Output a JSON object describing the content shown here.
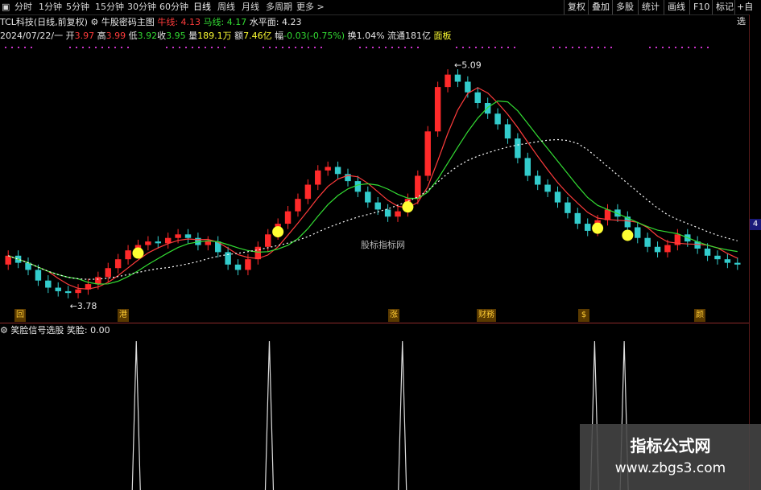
{
  "toolbar": {
    "periods": [
      "分时",
      "1分钟",
      "5分钟",
      "15分钟",
      "30分钟",
      "60分钟",
      "日线",
      "周线",
      "月线",
      "多周期",
      "更多"
    ],
    "active": "日线",
    "right_buttons": [
      "复权",
      "叠加",
      "多股",
      "统计",
      "画线",
      "F10",
      "标记",
      "+自选"
    ]
  },
  "header": {
    "stock": "TCL科技(日线,前复权)",
    "indicator": "牛股密码主图",
    "niu_label": "牛线:",
    "niu_value": "4.13",
    "ma_label": "马线:",
    "ma_value": "4.17",
    "level_label": "水平面:",
    "level_value": "4.23"
  },
  "quote": {
    "date": "2024/07/22/一",
    "open_label": "开",
    "open": "3.97",
    "high_label": "高",
    "high": "3.99",
    "low_label": "低",
    "low": "3.92",
    "close_label": "收",
    "close": "3.95",
    "vol_label": "量",
    "vol": "189.1万",
    "amt_label": "额",
    "amt": "7.46亿",
    "chg_label": "幅",
    "chg": "-0.03(-0.75%)",
    "turn_label": "换",
    "turn": "1.04%",
    "float_label": "流通",
    "float": "181亿",
    "board": "面板"
  },
  "chart_labels": {
    "high_marker": "5.09",
    "low_marker": "3.78",
    "center_watermark": "股标指标网",
    "axis_tag": "4"
  },
  "events": [
    {
      "label": "回"
    },
    {
      "label": "港"
    },
    {
      "label": "涨"
    },
    {
      "label": "财務"
    },
    {
      "label": "$"
    },
    {
      "label": "颜"
    }
  ],
  "sub_indicator": {
    "name": "笑脸信号选股",
    "value_label": "笑脸:",
    "value": "0.00"
  },
  "watermark": {
    "line1": "指标公式网",
    "line2": "www.zbgs3.com"
  },
  "colors": {
    "up": "#ff2a2a",
    "down": "#33cccc",
    "blue": "#2244ff",
    "yellow": "#ffff33",
    "ma_red": "#ff3b3b",
    "ma_green": "#33dd33",
    "level": "#ffffff"
  },
  "chart_data": {
    "type": "line",
    "candles": [
      [
        3.95,
        4.0
      ],
      [
        4.0,
        3.96
      ],
      [
        3.96,
        3.92
      ],
      [
        3.92,
        3.86
      ],
      [
        3.86,
        3.82
      ],
      [
        3.82,
        3.8
      ],
      [
        3.8,
        3.79
      ],
      [
        3.79,
        3.81
      ],
      [
        3.81,
        3.84
      ],
      [
        3.84,
        3.88
      ],
      [
        3.88,
        3.93
      ],
      [
        3.93,
        3.98
      ],
      [
        3.98,
        4.03
      ],
      [
        4.03,
        4.06
      ],
      [
        4.06,
        4.08
      ],
      [
        4.08,
        4.07
      ],
      [
        4.07,
        4.1
      ],
      [
        4.1,
        4.12
      ],
      [
        4.12,
        4.1
      ],
      [
        4.1,
        4.06
      ],
      [
        4.06,
        4.08
      ],
      [
        4.08,
        4.02
      ],
      [
        4.02,
        3.95
      ],
      [
        3.95,
        3.92
      ],
      [
        3.92,
        3.98
      ],
      [
        3.98,
        4.05
      ],
      [
        4.05,
        4.12
      ],
      [
        4.12,
        4.18
      ],
      [
        4.18,
        4.25
      ],
      [
        4.25,
        4.32
      ],
      [
        4.32,
        4.4
      ],
      [
        4.4,
        4.48
      ],
      [
        4.48,
        4.5
      ],
      [
        4.5,
        4.46
      ],
      [
        4.46,
        4.42
      ],
      [
        4.42,
        4.36
      ],
      [
        4.36,
        4.3
      ],
      [
        4.3,
        4.26
      ],
      [
        4.26,
        4.22
      ],
      [
        4.22,
        4.25
      ],
      [
        4.25,
        4.32
      ],
      [
        4.32,
        4.45
      ],
      [
        4.45,
        4.7
      ],
      [
        4.7,
        4.95
      ],
      [
        4.95,
        5.02
      ],
      [
        5.02,
        4.98
      ],
      [
        4.98,
        4.92
      ],
      [
        4.92,
        4.86
      ],
      [
        4.86,
        4.8
      ],
      [
        4.8,
        4.74
      ],
      [
        4.74,
        4.66
      ],
      [
        4.66,
        4.55
      ],
      [
        4.55,
        4.45
      ],
      [
        4.45,
        4.4
      ],
      [
        4.4,
        4.36
      ],
      [
        4.36,
        4.3
      ],
      [
        4.3,
        4.24
      ],
      [
        4.24,
        4.18
      ],
      [
        4.18,
        4.14
      ],
      [
        4.14,
        4.2
      ],
      [
        4.2,
        4.26
      ],
      [
        4.26,
        4.22
      ],
      [
        4.22,
        4.16
      ],
      [
        4.16,
        4.1
      ],
      [
        4.1,
        4.05
      ],
      [
        4.05,
        4.02
      ],
      [
        4.02,
        4.06
      ],
      [
        4.06,
        4.12
      ],
      [
        4.12,
        4.08
      ],
      [
        4.08,
        4.04
      ],
      [
        4.04,
        4.0
      ],
      [
        4.0,
        3.98
      ],
      [
        3.98,
        3.96
      ],
      [
        3.96,
        3.95
      ]
    ],
    "spikes": [
      0.18,
      0.36,
      0.54,
      0.8,
      0.84
    ],
    "ylim": [
      3.7,
      5.15
    ]
  }
}
